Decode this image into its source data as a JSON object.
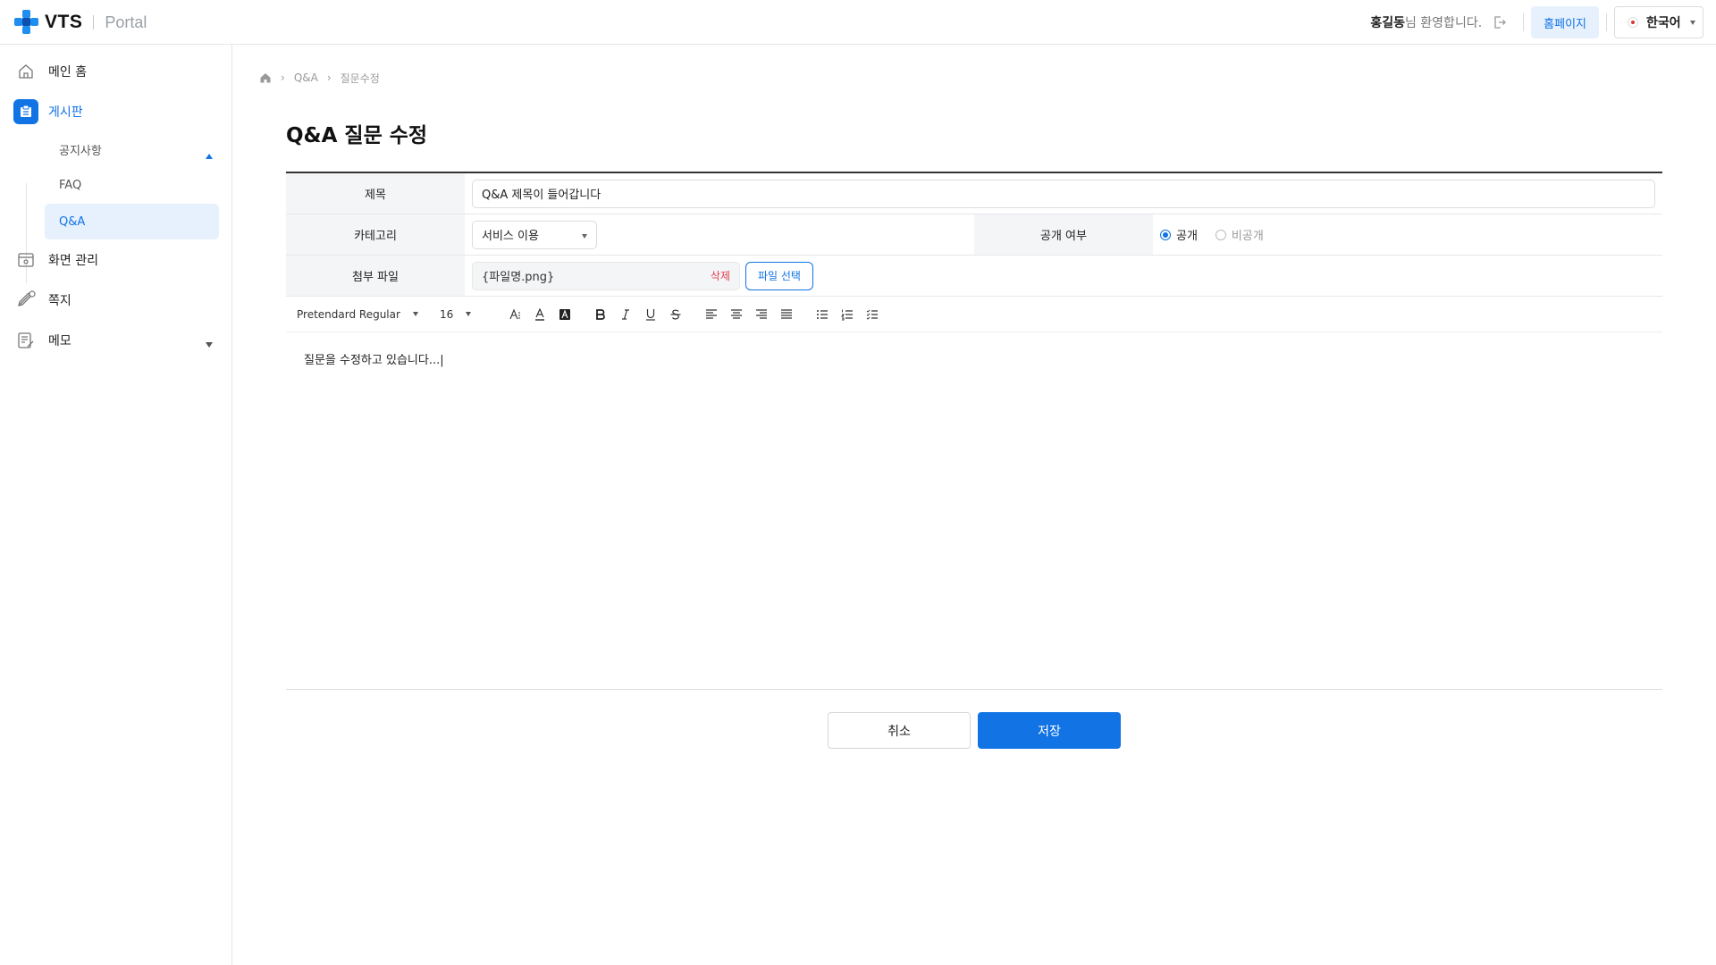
{
  "header": {
    "logo_text": "VTS",
    "logo_sub": "Portal",
    "user_name": "홍길동",
    "welcome_suffix": "님 환영합니다.",
    "home_button": "홈페이지",
    "language": "한국어"
  },
  "sidebar": {
    "items": [
      {
        "label": "메인 홈",
        "icon": "home-icon"
      },
      {
        "label": "게시판",
        "icon": "board-icon",
        "expanded": true
      },
      {
        "label": "화면 관리",
        "icon": "screen-icon"
      },
      {
        "label": "쪽지",
        "icon": "message-icon",
        "expanded": false
      },
      {
        "label": "메모",
        "icon": "memo-icon"
      }
    ],
    "board_sub": [
      {
        "label": "공지사항"
      },
      {
        "label": "FAQ"
      },
      {
        "label": "Q&A",
        "active": true
      }
    ]
  },
  "breadcrumb": [
    "Q&A",
    "질문수정"
  ],
  "page_title": "Q&A 질문 수정",
  "form": {
    "title_label": "제목",
    "title_value": "Q&A 제목이 들어갑니다",
    "category_label": "카테고리",
    "category_value": "서비스 이용",
    "visibility_label": "공개 여부",
    "visibility_options": [
      "공개",
      "비공개"
    ],
    "visibility_selected": "공개",
    "attach_label": "첨부 파일",
    "attach_filename": "{파일명.png}",
    "attach_delete": "삭제",
    "attach_select": "파일 선택"
  },
  "editor": {
    "font_family": "Pretendard Regular",
    "font_size": "16",
    "content": "질문을 수정하고 있습니다...|"
  },
  "actions": {
    "cancel": "취소",
    "save": "저장"
  },
  "colors": {
    "accent": "#1273e5",
    "accent_light": "#e6f1fd",
    "danger": "#e2404f"
  }
}
